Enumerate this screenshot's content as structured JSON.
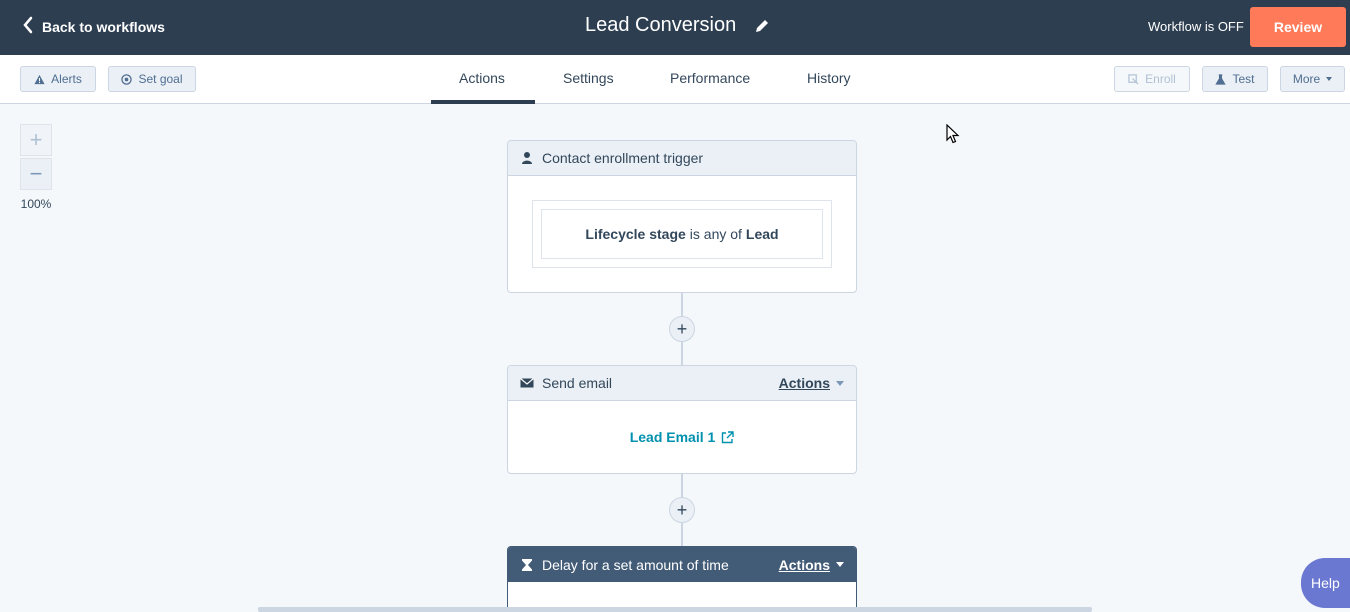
{
  "header": {
    "back_label": "Back to workflows",
    "workflow_title": "Lead Conversion",
    "status": "Workflow is OFF",
    "review_label": "Review"
  },
  "toolbar": {
    "alerts_label": "Alerts",
    "set_goal_label": "Set goal",
    "enroll_label": "Enroll",
    "test_label": "Test",
    "more_label": "More"
  },
  "tabs": [
    {
      "label": "Actions",
      "active": true
    },
    {
      "label": "Settings",
      "active": false
    },
    {
      "label": "Performance",
      "active": false
    },
    {
      "label": "History",
      "active": false
    }
  ],
  "zoom": {
    "plus": "+",
    "minus": "−",
    "level": "100%"
  },
  "workflow": {
    "trigger": {
      "title": "Contact enrollment trigger",
      "property": "Lifecycle stage",
      "operator": "is any of",
      "value": "Lead"
    },
    "add_step": "+",
    "send_email": {
      "title": "Send email",
      "actions_label": "Actions",
      "email_name": "Lead Email 1"
    },
    "delay": {
      "title": "Delay for a set amount of time",
      "actions_label": "Actions"
    }
  },
  "help_label": "Help",
  "colors": {
    "header_bg": "#2d3e50",
    "review": "#ff7a59",
    "link": "#0091ae",
    "delay_head": "#425b76",
    "help": "#6a78d1"
  },
  "icons": [
    "chevron-left-icon",
    "pencil-icon",
    "warning-icon",
    "target-icon",
    "enroll-icon",
    "flask-icon",
    "caret-down-icon",
    "person-icon",
    "envelope-icon",
    "external-link-icon",
    "hourglass-icon",
    "mouse-cursor-icon"
  ]
}
